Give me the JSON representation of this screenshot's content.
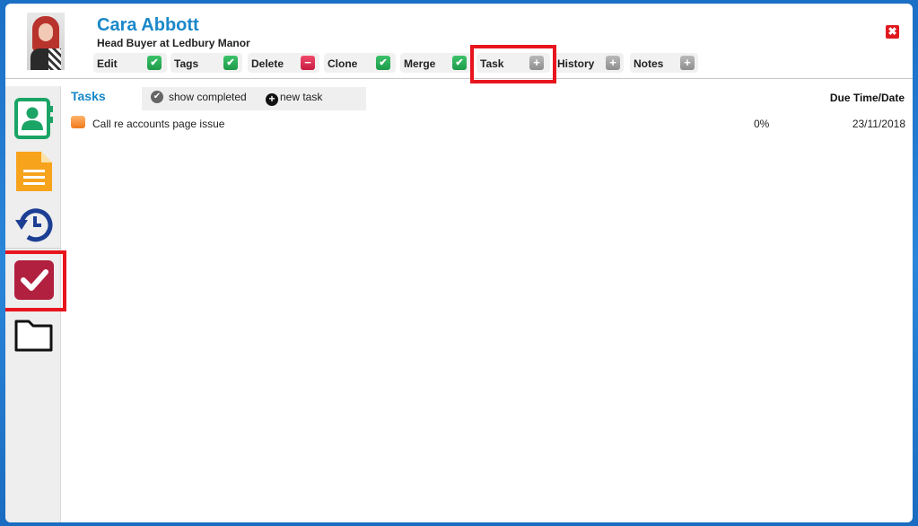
{
  "contact": {
    "name": "Cara Abbott",
    "role": "Head Buyer at Ledbury Manor"
  },
  "header": {
    "close_glyph": "✖"
  },
  "actions": [
    {
      "label": "Edit",
      "icon": "check-icon",
      "glyph": "✔"
    },
    {
      "label": "Tags",
      "icon": "check-icon",
      "glyph": "✔"
    },
    {
      "label": "Delete",
      "icon": "minus-icon",
      "glyph": "−"
    },
    {
      "label": "Clone",
      "icon": "check-icon",
      "glyph": "✔"
    },
    {
      "label": "Merge",
      "icon": "check-icon",
      "glyph": "✔"
    },
    {
      "label": "Task",
      "icon": "plus-icon",
      "glyph": "+"
    },
    {
      "label": "History",
      "icon": "plus-icon",
      "glyph": "+"
    },
    {
      "label": "Notes",
      "icon": "plus-icon",
      "glyph": "+"
    }
  ],
  "sidebar": {
    "items": [
      "contact-card-icon",
      "document-icon",
      "history-icon",
      "tasks-icon",
      "folder-icon"
    ],
    "active": "tasks-icon"
  },
  "tasks": {
    "title": "Tasks",
    "show_completed": "show completed",
    "new_task": "new task",
    "due_header": "Due Time/Date",
    "rows": [
      {
        "name": "Call re accounts page issue",
        "progress": "0%",
        "due": "23/11/2018",
        "priority_color": "#f58a2a"
      }
    ]
  },
  "colors": {
    "accent": "#1a88c9",
    "highlight": "#e8151d",
    "background": "#1f78cc"
  }
}
